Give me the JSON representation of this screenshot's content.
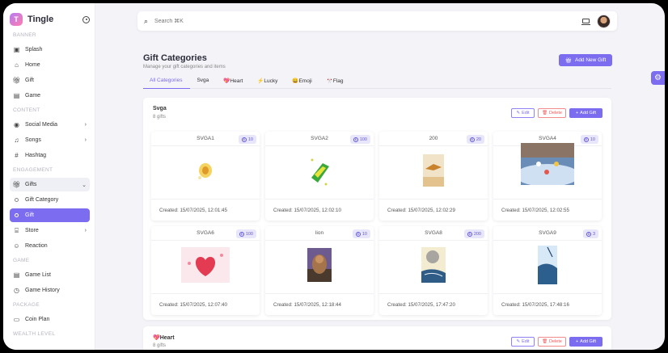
{
  "brand": {
    "name": "Tingle",
    "logo_letter": "T"
  },
  "sidebar": {
    "sections": [
      {
        "title": "BANNER",
        "items": [
          {
            "label": "Splash",
            "icon": "image-icon"
          },
          {
            "label": "Home",
            "icon": "home-icon"
          },
          {
            "label": "Gift",
            "icon": "gift-icon"
          },
          {
            "label": "Game",
            "icon": "game-icon"
          }
        ]
      },
      {
        "title": "CONTENT",
        "items": [
          {
            "label": "Social Media",
            "icon": "social-icon",
            "chevron": "›"
          },
          {
            "label": "Songs",
            "icon": "music-icon",
            "chevron": "›"
          },
          {
            "label": "Hashtag",
            "icon": "hashtag-icon"
          }
        ]
      },
      {
        "title": "ENGAGEMENT",
        "items": [
          {
            "label": "Gifts",
            "icon": "gift-icon",
            "chevron": "⌄"
          },
          {
            "label": "Gift Category"
          },
          {
            "label": "Gift"
          },
          {
            "label": "Store",
            "icon": "store-icon",
            "chevron": "›"
          },
          {
            "label": "Reaction",
            "icon": "reaction-icon"
          }
        ]
      },
      {
        "title": "GAME",
        "items": [
          {
            "label": "Game List",
            "icon": "game-icon"
          },
          {
            "label": "Game History",
            "icon": "history-icon"
          }
        ]
      },
      {
        "title": "PACKAGE",
        "items": [
          {
            "label": "Coin Plan",
            "icon": "coin-icon"
          }
        ]
      },
      {
        "title": "WEALTH LEVEL",
        "items": []
      }
    ]
  },
  "search": {
    "placeholder": "Search ⌘K"
  },
  "page": {
    "title": "Gift Categories",
    "subtitle": "Manage your gift categories and items",
    "add_new_label": "Add New Gift"
  },
  "tabs": [
    {
      "label": "All Categories"
    },
    {
      "label": "Svga"
    },
    {
      "label": "💖Heart"
    },
    {
      "label": "⚡Lucky"
    },
    {
      "label": "😀Emoji"
    },
    {
      "label": "🎌Flag"
    }
  ],
  "panels": [
    {
      "title": "Svga",
      "count": "8 gifts",
      "edit_label": "Edit",
      "delete_label": "Delete",
      "add_label": "Add Gift",
      "gifts": [
        {
          "name": "SVGA1",
          "price": "10",
          "created": "Created: 15/07/2025, 12:01:45",
          "preview": "lantern"
        },
        {
          "name": "SVGA2",
          "price": "100",
          "created": "Created: 15/07/2025, 12:02:10",
          "preview": "car"
        },
        {
          "name": "200",
          "price": "20",
          "created": "Created: 15/07/2025, 12:02:29",
          "preview": "bird"
        },
        {
          "name": "SVGA4",
          "price": "10",
          "created": "Created: 15/07/2025, 12:02:55",
          "preview": "sky"
        },
        {
          "name": "SVGA6",
          "price": "100",
          "created": "Created: 15/07/2025, 12:07:40",
          "preview": "heart"
        },
        {
          "name": "lion",
          "price": "10",
          "created": "Created: 15/07/2025, 12:18:44",
          "preview": "lion"
        },
        {
          "name": "SVGA8",
          "price": "200",
          "created": "Created: 15/07/2025, 17:47:20",
          "preview": "moon"
        },
        {
          "name": "SVGA9",
          "price": "3",
          "created": "Created: 15/07/2025, 17:48:16",
          "preview": "wave"
        }
      ]
    },
    {
      "title": "💖Heart",
      "count": "8 gifts",
      "edit_label": "Edit",
      "delete_label": "Delete",
      "add_label": "Add Gift",
      "gifts": []
    }
  ],
  "colors": {
    "accent": "#7c6cf0",
    "danger": "#e55555"
  }
}
